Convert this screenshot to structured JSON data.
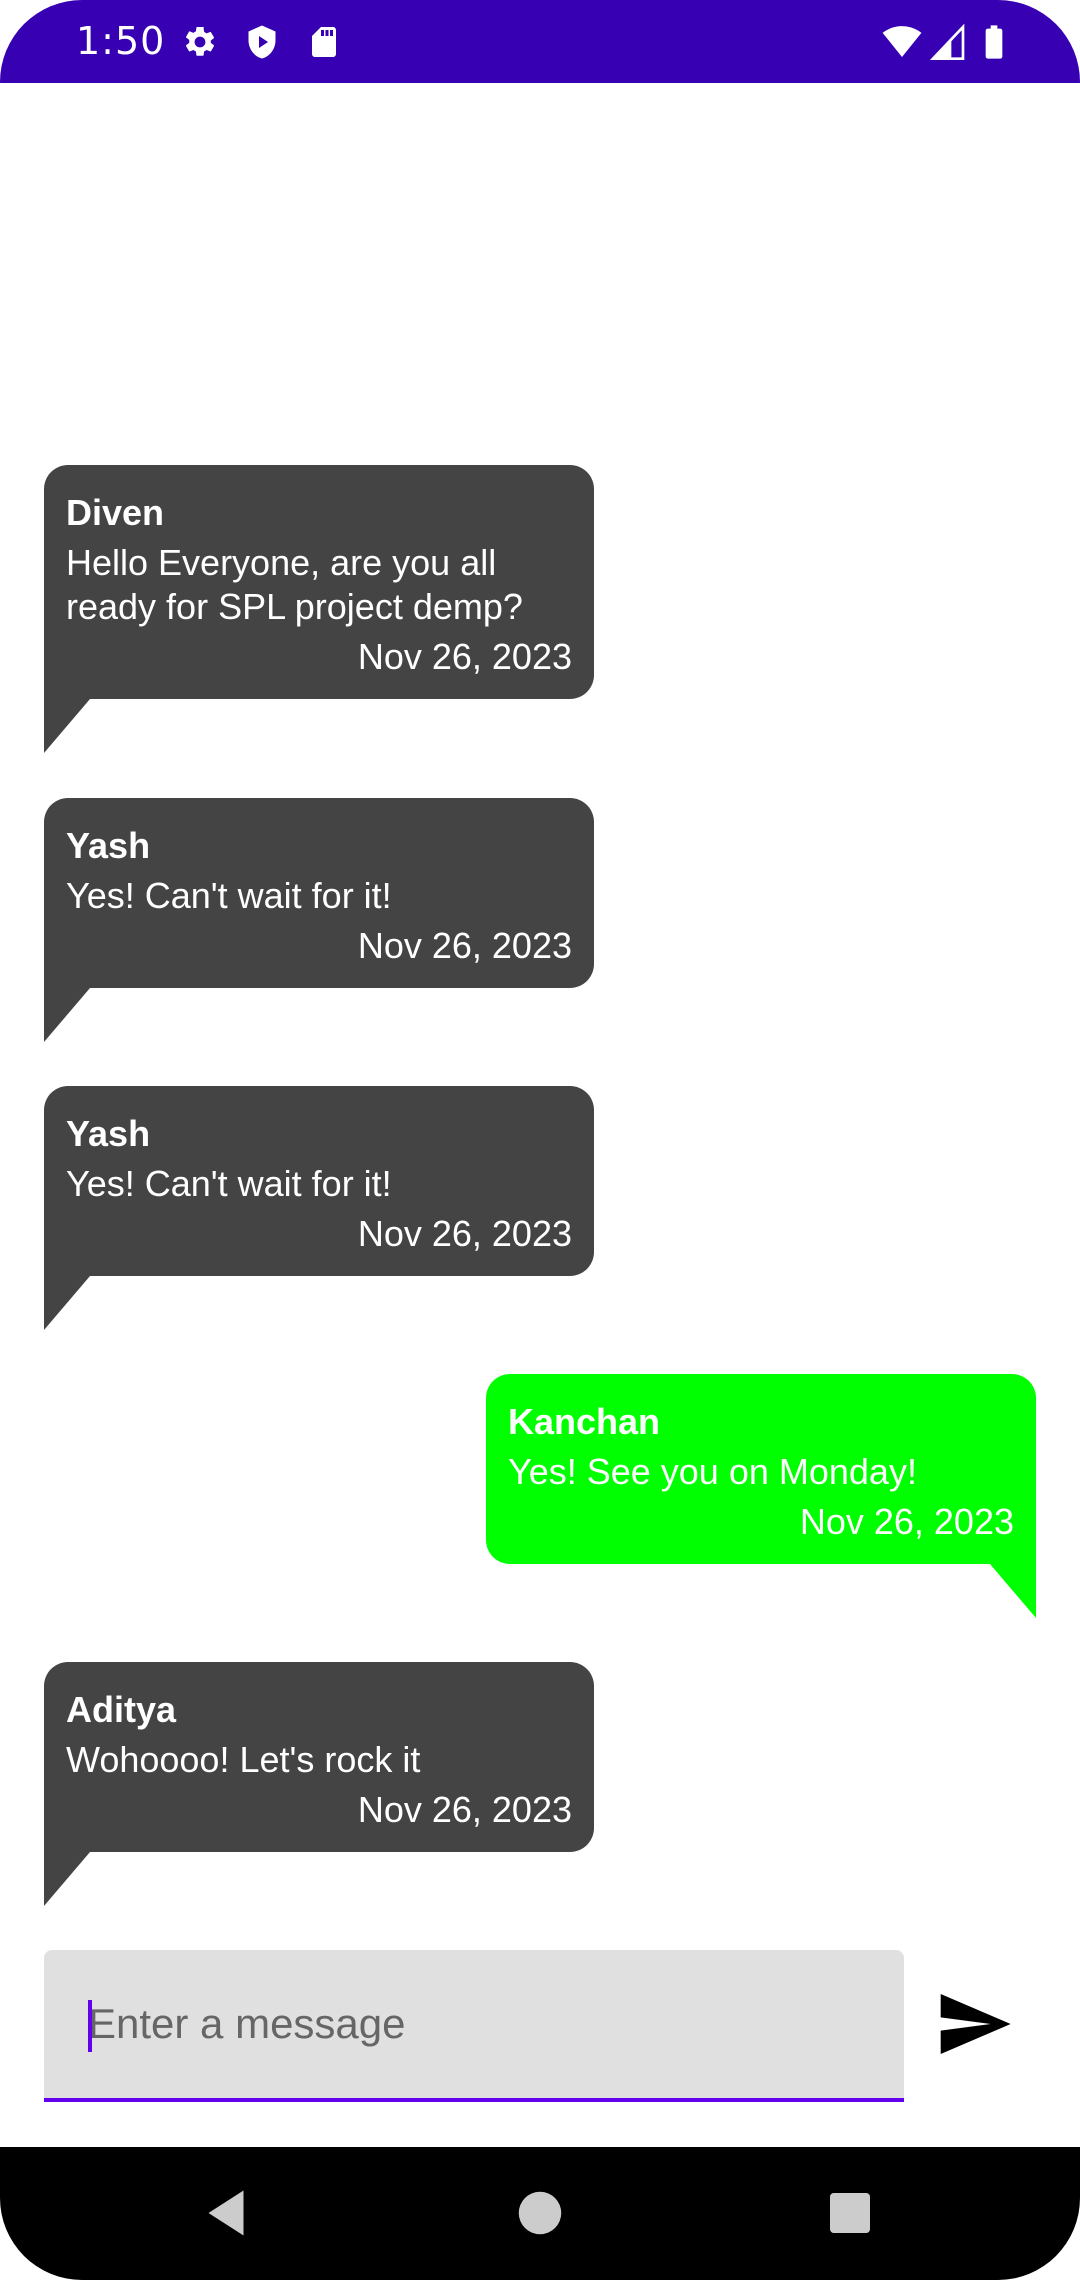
{
  "status_bar": {
    "time": "1:50",
    "left_icons": [
      "settings-gear-icon",
      "play-protect-icon",
      "sd-card-icon"
    ],
    "right_icons": [
      "wifi-icon",
      "cell-signal-icon",
      "battery-icon"
    ],
    "background_color": "#3700B3"
  },
  "messages": [
    {
      "sender": "Diven",
      "text": "Hello Everyone, are you all ready for SPL project demp?",
      "date": "Nov 26, 2023",
      "direction": "incoming",
      "bubble_color": "#444444"
    },
    {
      "sender": "Yash",
      "text": "Yes! Can't wait for it!",
      "date": "Nov 26, 2023",
      "direction": "incoming",
      "bubble_color": "#444444"
    },
    {
      "sender": "Yash",
      "text": "Yes! Can't wait for it!",
      "date": "Nov 26, 2023",
      "direction": "incoming",
      "bubble_color": "#444444"
    },
    {
      "sender": "Kanchan",
      "text": "Yes! See you on Monday!",
      "date": "Nov 26, 2023",
      "direction": "outgoing",
      "bubble_color": "#00FF00"
    },
    {
      "sender": "Aditya",
      "text": "Wohoooo! Let's rock it",
      "date": "Nov 26, 2023",
      "direction": "incoming",
      "bubble_color": "#444444"
    }
  ],
  "composer": {
    "placeholder": "Enter a message",
    "value": "",
    "send_icon": "send-icon",
    "accent_color": "#6200EE"
  },
  "nav_bar": {
    "icons": [
      "back-icon",
      "home-icon",
      "recents-icon"
    ]
  }
}
